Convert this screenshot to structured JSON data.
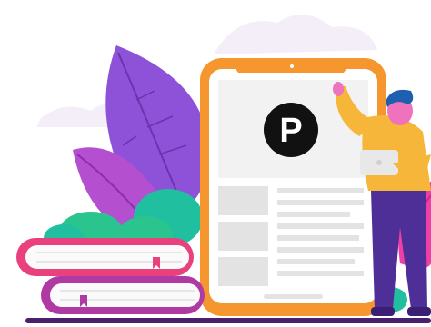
{
  "illustration": {
    "logo_letter": "P",
    "colors": {
      "background": "#ffffff",
      "cloud": "#f4eef8",
      "leaf_purple": "#8e52d8",
      "leaf_magenta": "#b44fd0",
      "leaf_pink": "#ee3fa6",
      "bush_teal": "#1fbf9f",
      "bush_green": "#2ac58f",
      "tablet_frame": "#f5962e",
      "tablet_screen": "#f2f2f2",
      "content_block": "#e3e3e3",
      "logo_circle": "#111111",
      "book_pink": "#e9417e",
      "book_purple": "#b03aa3",
      "page_white": "#fafafa",
      "shirt": "#f5b63a",
      "pants": "#4e2f97",
      "hair": "#1e5fb0",
      "skin": "#ee72bc",
      "laptop": "#e8e8e8",
      "ground": "#4b1e6e"
    }
  }
}
